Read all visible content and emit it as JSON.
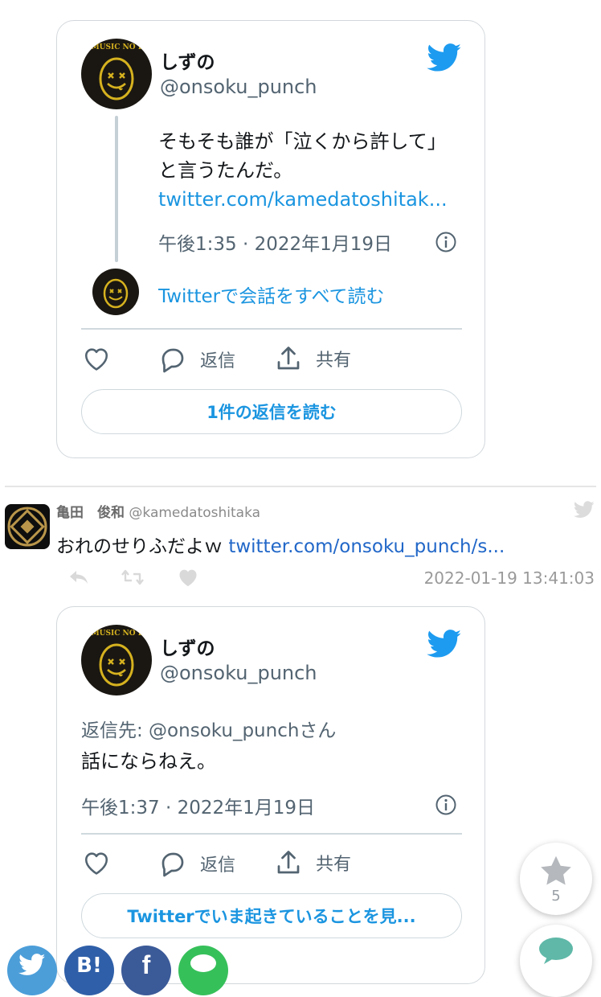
{
  "tweet1": {
    "user_name": "しずの",
    "user_handle": "@onsoku_punch",
    "avatar_text": "NO MUSIC NO LIFE",
    "text_line1": "そもそも誰が「泣くから許して」",
    "text_line2": "と言うたんだ。",
    "link": "twitter.com/kamedatoshitak...",
    "timestamp": "午後1:35 · 2022年1月19日",
    "read_all": "Twitterで会話をすべて読む",
    "reply_label": "返信",
    "share_label": "共有",
    "button_label": "1件の返信を読む"
  },
  "log_entry": {
    "name": "亀田　俊和",
    "handle": "@kamedatoshitaka",
    "text": "おれのせりふだよｗ",
    "link": "twitter.com/onsoku_punch/s...",
    "time": "2022-01-19 13:41:03"
  },
  "tweet2": {
    "user_name": "しずの",
    "user_handle": "@onsoku_punch",
    "avatar_text": "NO MUSIC NO LIFE",
    "reply_to": "返信先: @onsoku_punchさん",
    "text": "話にならねえ。",
    "timestamp": "午後1:37 · 2022年1月19日",
    "reply_label": "返信",
    "share_label": "共有",
    "button_label": "Twitterでいま起きていることを見..."
  },
  "fab": {
    "star_count": "5"
  },
  "share_bar": {
    "hatena_label": "B!",
    "facebook_label": "f"
  },
  "colors": {
    "twitter_blue": "#1b95e0",
    "log_link": "#2167c8",
    "avatar_yellow": "#d6b21f"
  }
}
